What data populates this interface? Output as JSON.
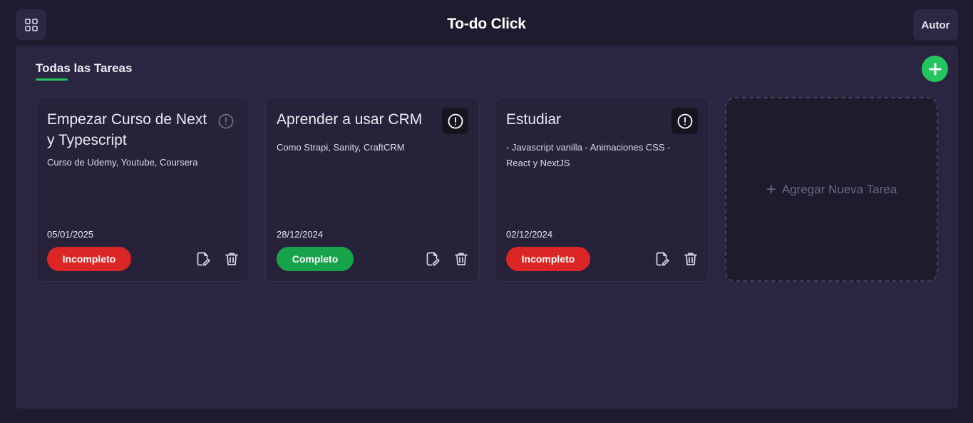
{
  "header": {
    "title": "To-do Click",
    "author_label": "Autor",
    "menu_icon": "grid-icon"
  },
  "section": {
    "title": "Todas las Tareas",
    "accent_color": "#22c55e"
  },
  "tasks": [
    {
      "title": "Empezar Curso de Next y Typescript",
      "description": "Curso de Udemy, Youtube, Coursera",
      "date": "05/01/2025",
      "status": "Incompleto",
      "status_color": "#dc2626",
      "important": false
    },
    {
      "title": "Aprender a usar CRM",
      "description": "Como Strapi, Sanity, CraftCRM",
      "date": "28/12/2024",
      "status": "Completo",
      "status_color": "#16a34a",
      "important": true
    },
    {
      "title": "Estudiar",
      "description": "- Javascript vanilla - Animaciones CSS - React y NextJS",
      "date": "02/12/2024",
      "status": "Incompleto",
      "status_color": "#dc2626",
      "important": true
    }
  ],
  "new_task": {
    "label": "Agregar Nueva Tarea",
    "plus": "+"
  }
}
